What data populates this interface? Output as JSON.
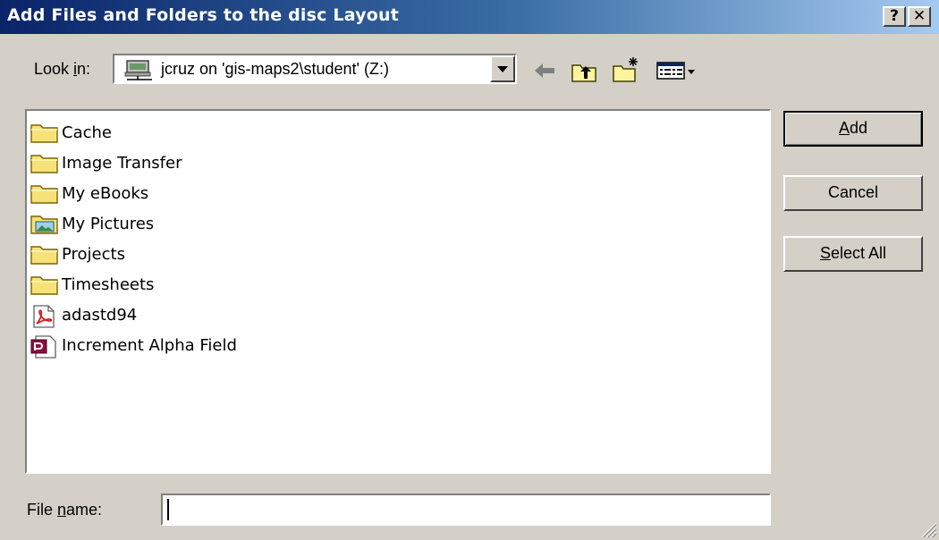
{
  "window": {
    "title": "Add Files and Folders to the disc Layout",
    "help_label": "?",
    "close_label": "✕"
  },
  "lookin": {
    "label_pre": "Look ",
    "label_accel": "i",
    "label_post": "n:",
    "value": "jcruz on 'gis-maps2\\student' (Z:)",
    "value_icon": "network-drive-icon"
  },
  "toolbar": {
    "icons": [
      "back-arrow-icon",
      "up-folder-icon",
      "new-folder-icon",
      "view-menu-icon"
    ]
  },
  "files": [
    {
      "name": "Cache",
      "icon": "folder-icon"
    },
    {
      "name": "Image Transfer",
      "icon": "folder-icon"
    },
    {
      "name": "My eBooks",
      "icon": "folder-icon"
    },
    {
      "name": "My Pictures",
      "icon": "pictures-folder-icon"
    },
    {
      "name": "Projects",
      "icon": "folder-icon"
    },
    {
      "name": "Timesheets",
      "icon": "folder-icon"
    },
    {
      "name": "adastd94",
      "icon": "pdf-file-icon"
    },
    {
      "name": "Increment Alpha Field",
      "icon": "access-file-icon"
    }
  ],
  "buttons": {
    "add_accel": "A",
    "add_rest": "dd",
    "cancel": "Cancel",
    "select_all_accel": "S",
    "select_all_rest": "elect All"
  },
  "filename": {
    "label_pre": "File ",
    "label_accel": "n",
    "label_post": "ame:",
    "value": ""
  },
  "colors": {
    "titlebar_start": "#0a246a",
    "titlebar_end": "#a6caf0",
    "face": "#d4d0c8"
  }
}
